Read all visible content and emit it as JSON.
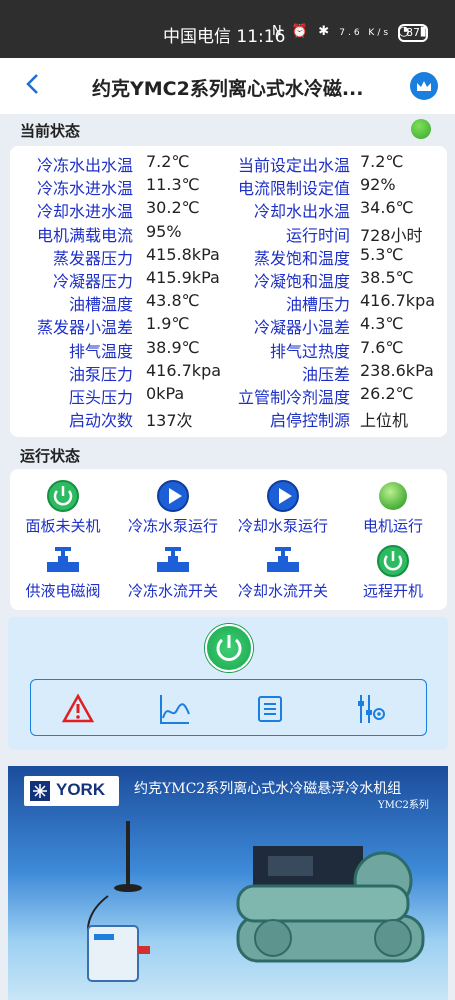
{
  "statusbar": {
    "carrier_time": "中国电信 11:16",
    "speed": "7.6 K/s",
    "battery": "87"
  },
  "header": {
    "title": "约克YMC2系列离心式水冷磁..."
  },
  "current_status": {
    "title": "当前状态",
    "left": [
      {
        "label": "冷冻水出水温",
        "value": "7.2℃"
      },
      {
        "label": "冷冻水进水温",
        "value": "11.3℃"
      },
      {
        "label": "冷却水进水温",
        "value": "30.2℃"
      },
      {
        "label": "电机满载电流",
        "value": "95%"
      },
      {
        "label": "蒸发器压力",
        "value": "415.8kPa"
      },
      {
        "label": "冷凝器压力",
        "value": "415.9kPa"
      },
      {
        "label": "油槽温度",
        "value": "43.8℃"
      },
      {
        "label": "蒸发器小温差",
        "value": "1.9℃"
      },
      {
        "label": "排气温度",
        "value": "38.9℃"
      },
      {
        "label": "油泵压力",
        "value": "416.7kpa"
      },
      {
        "label": "压头压力",
        "value": "0kPa"
      },
      {
        "label": "启动次数",
        "value": "137次"
      }
    ],
    "right": [
      {
        "label": "当前设定出水温",
        "value": "7.2℃"
      },
      {
        "label": "电流限制设定值",
        "value": "92%"
      },
      {
        "label": "冷却水出水温",
        "value": "34.6℃"
      },
      {
        "label": "运行时间",
        "value": "728小时"
      },
      {
        "label": "蒸发饱和温度",
        "value": "5.3℃"
      },
      {
        "label": "冷凝饱和温度",
        "value": "38.5℃"
      },
      {
        "label": "油槽压力",
        "value": "416.7kpa"
      },
      {
        "label": "冷凝器小温差",
        "value": "4.3℃"
      },
      {
        "label": "排气过热度",
        "value": "7.6℃"
      },
      {
        "label": "油压差",
        "value": "238.6kPa"
      },
      {
        "label": "立管制冷剂温度",
        "value": "26.2℃"
      },
      {
        "label": "启停控制源",
        "value": "上位机"
      }
    ]
  },
  "run_status": {
    "title": "运行状态",
    "items": [
      {
        "label": "面板未关机",
        "icon": "power-icon"
      },
      {
        "label": "冷冻水泵运行",
        "icon": "play-icon"
      },
      {
        "label": "冷却水泵运行",
        "icon": "play-icon"
      },
      {
        "label": "电机运行",
        "icon": "led-icon"
      },
      {
        "label": "供液电磁阀",
        "icon": "valve-icon"
      },
      {
        "label": "冷冻水流开关",
        "icon": "valve-icon"
      },
      {
        "label": "冷却水流开关",
        "icon": "valve-icon"
      },
      {
        "label": "远程开机",
        "icon": "power-icon"
      }
    ]
  },
  "banner": {
    "brand": "YORK",
    "title": "约克YMC2系列离心式水冷磁悬浮冷水机组",
    "subtitle": "YMC2系列"
  }
}
